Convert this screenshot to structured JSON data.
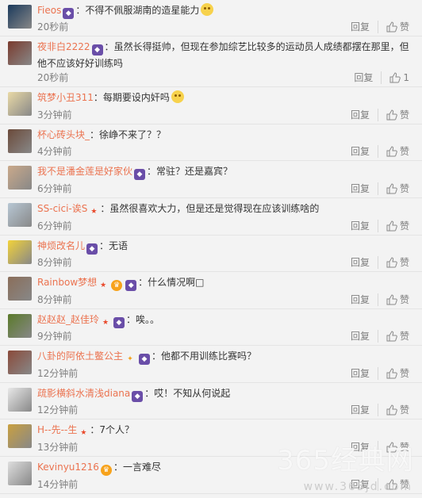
{
  "comments": [
    {
      "name": "Fieos",
      "badges": [
        "vip"
      ],
      "sep": "：",
      "text": "不得不佩服湖南的造星能力",
      "emoji": true,
      "time": "20秒前",
      "reply": "回复",
      "like": "赞",
      "avatar_color": "#1b3a5c",
      "lines": 1
    },
    {
      "name": "夜非白2222",
      "badges": [
        "vip"
      ],
      "sep": "：",
      "text": "虽然长得挺帅，但现在参加综艺比较多的运动员人成绩都摆在那里，但他不应该好好训练吗",
      "emoji": false,
      "time": "20秒前",
      "reply": "回复",
      "like": "1",
      "avatar_color": "#7a3b2e",
      "lines": 2
    },
    {
      "name": "筑梦小丑311",
      "badges": [],
      "sep": "：",
      "text": "每期要设内奸吗",
      "emoji": true,
      "time": "3分钟前",
      "reply": "回复",
      "like": "赞",
      "avatar_color": "#e9d9a6",
      "lines": 1
    },
    {
      "name": "杯心砖头块_",
      "badges": [],
      "sep": "：",
      "text": "徐峥不来了？？",
      "emoji": false,
      "time": "4分钟前",
      "reply": "回复",
      "like": "赞",
      "avatar_color": "#6b4a3a",
      "lines": 1
    },
    {
      "name": "我不是潘金莲是好家伙",
      "badges": [
        "vip"
      ],
      "sep": "：",
      "text": "常驻？还是嘉宾？",
      "emoji": false,
      "time": "6分钟前",
      "reply": "回复",
      "like": "赞",
      "avatar_color": "#caa98a",
      "lines": 1
    },
    {
      "name": "SS-cici-诶S",
      "badges": [
        "star"
      ],
      "sep": "：",
      "text": "虽然很喜欢大力，但是还是觉得现在应该训练啥的",
      "emoji": false,
      "time": "6分钟前",
      "reply": "回复",
      "like": "赞",
      "avatar_color": "#b7c7d4",
      "lines": 1
    },
    {
      "name": "神烦改名儿",
      "badges": [
        "vip"
      ],
      "sep": "：",
      "text": "无语",
      "emoji": false,
      "time": "8分钟前",
      "reply": "回复",
      "like": "赞",
      "avatar_color": "#f2d23a",
      "lines": 1
    },
    {
      "name": "Rainbow梦想",
      "badges": [
        "star",
        "crown",
        "vip"
      ],
      "sep": "：",
      "text": "什么情况啊□",
      "emoji": false,
      "time": "8分钟前",
      "reply": "回复",
      "like": "赞",
      "avatar_color": "#8a6e5a",
      "lines": 1
    },
    {
      "name": "赵赵赵_赵佳玲",
      "badges": [
        "star",
        "vip"
      ],
      "sep": "：",
      "text": "唉。。",
      "emoji": false,
      "time": "9分钟前",
      "reply": "回复",
      "like": "赞",
      "avatar_color": "#5a7a2a",
      "lines": 1
    },
    {
      "name": "八卦的阿依土鳖公主",
      "badges": [
        "gift",
        "vip"
      ],
      "sep": "：",
      "text": "他都不用训练比赛吗？",
      "emoji": false,
      "time": "12分钟前",
      "reply": "回复",
      "like": "赞",
      "avatar_color": "#8a4a3a",
      "lines": 1
    },
    {
      "name": "疏影横斜水清浅diana",
      "badges": [
        "vip"
      ],
      "sep": "：",
      "text": "哎！不知从何说起",
      "emoji": false,
      "time": "12分钟前",
      "reply": "回复",
      "like": "赞",
      "avatar_color": "#e8e8e8",
      "lines": 1
    },
    {
      "name": "H--先--生",
      "badges": [
        "star"
      ],
      "sep": "：",
      "text": "7个人？",
      "emoji": false,
      "time": "13分钟前",
      "reply": "回复",
      "like": "赞",
      "avatar_color": "#c9a040",
      "lines": 1
    },
    {
      "name": "Kevinyu1216",
      "badges": [
        "crown"
      ],
      "sep": "：",
      "text": "一言难尽",
      "emoji": false,
      "time": "14分钟前",
      "reply": "回复",
      "like": "赞",
      "avatar_color": "#dedede",
      "lines": 1
    }
  ],
  "watermark": {
    "brand": "365经典网",
    "url": "www.365jd.com"
  }
}
